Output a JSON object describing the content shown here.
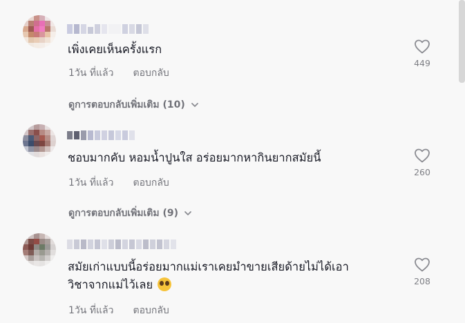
{
  "comments": [
    {
      "text": "เพิ่งเคยเห็นครั้งแรก",
      "time": "1วัน ที่แล้ว",
      "reply_label": "ตอบกลับ",
      "likes": "449",
      "more_replies": "ดูการตอบกลับเพิ่มเติม (10)"
    },
    {
      "text": "ชอบมากคับ หอมน้ำปูนใส อร่อยมากหากินยากสมัยนี้",
      "time": "1วัน ที่แล้ว",
      "reply_label": "ตอบกลับ",
      "likes": "260",
      "more_replies": "ดูการตอบกลับเพิ่มเติม (9)"
    },
    {
      "text_line1": "สมัยเก่าแบบนี้อร่อยมากแม่เราเคยมำขายเสียด้ายไม่ได้เอา",
      "text_line2": "วิชาจากแม่ไว้เลย",
      "time": "1วัน ที่แล้ว",
      "reply_label": "ตอบกลับ",
      "likes": "208",
      "emoji": "pleading-face-emoji"
    }
  ],
  "icons": {
    "like": "heart-outline-icon",
    "expand": "chevron-down-icon"
  },
  "colors": {
    "background": "#f8f8f8",
    "text": "#161823",
    "muted": "#8a8b91"
  }
}
